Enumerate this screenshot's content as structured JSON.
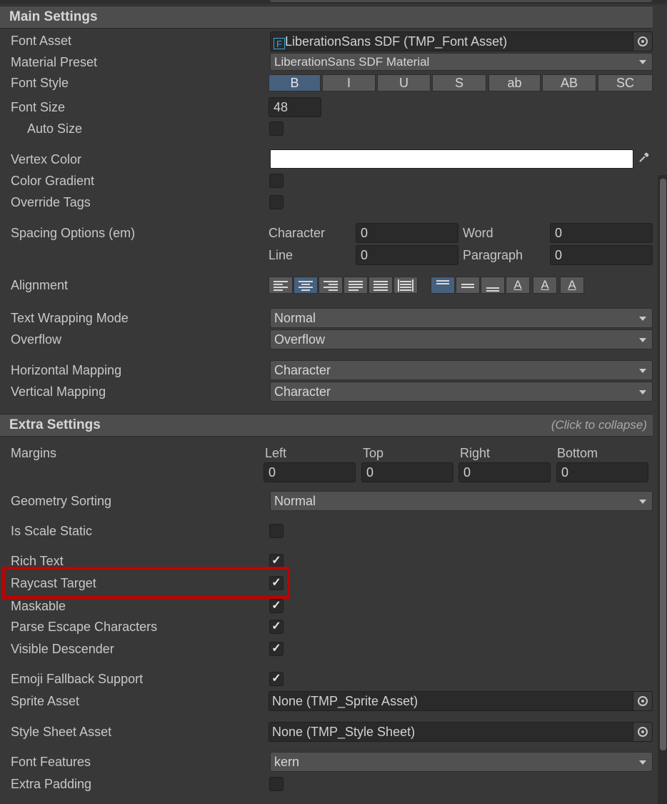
{
  "main_settings": {
    "header": "Main Settings",
    "font_asset": {
      "label": "Font Asset",
      "value": "LiberationSans SDF (TMP_Font Asset)",
      "icon": "font-asset-icon"
    },
    "material_preset": {
      "label": "Material Preset",
      "value": "LiberationSans SDF Material"
    },
    "font_style": {
      "label": "Font Style",
      "buttons": [
        "B",
        "I",
        "U",
        "S",
        "ab",
        "AB",
        "SC"
      ],
      "active": "B"
    },
    "font_size": {
      "label": "Font Size",
      "value": "48"
    },
    "auto_size": {
      "label": "Auto Size",
      "checked": false
    },
    "vertex_color": {
      "label": "Vertex Color",
      "color": "#ffffff"
    },
    "color_gradient": {
      "label": "Color Gradient",
      "checked": false
    },
    "override_tags": {
      "label": "Override Tags",
      "checked": false
    },
    "spacing": {
      "label": "Spacing Options (em)",
      "character_label": "Character",
      "character_value": "0",
      "word_label": "Word",
      "word_value": "0",
      "line_label": "Line",
      "line_value": "0",
      "paragraph_label": "Paragraph",
      "paragraph_value": "0"
    },
    "alignment": {
      "label": "Alignment",
      "horizontal_active": "center",
      "vertical_active": "top"
    },
    "text_wrapping": {
      "label": "Text Wrapping Mode",
      "value": "Normal"
    },
    "overflow": {
      "label": "Overflow",
      "value": "Overflow"
    },
    "horizontal_mapping": {
      "label": "Horizontal Mapping",
      "value": "Character"
    },
    "vertical_mapping": {
      "label": "Vertical Mapping",
      "value": "Character"
    }
  },
  "extra_settings": {
    "header": "Extra Settings",
    "hint": "(Click to collapse)",
    "margins": {
      "label": "Margins",
      "left_label": "Left",
      "left_value": "0",
      "top_label": "Top",
      "top_value": "0",
      "right_label": "Right",
      "right_value": "0",
      "bottom_label": "Bottom",
      "bottom_value": "0"
    },
    "geometry_sorting": {
      "label": "Geometry Sorting",
      "value": "Normal"
    },
    "is_scale_static": {
      "label": "Is Scale Static",
      "checked": false
    },
    "rich_text": {
      "label": "Rich Text",
      "checked": true
    },
    "raycast_target": {
      "label": "Raycast Target",
      "checked": true,
      "highlighted": true
    },
    "maskable": {
      "label": "Maskable",
      "checked": true
    },
    "parse_escape": {
      "label": "Parse Escape Characters",
      "checked": true
    },
    "visible_descender": {
      "label": "Visible Descender",
      "checked": true
    },
    "emoji_fallback": {
      "label": "Emoji Fallback Support",
      "checked": true
    },
    "sprite_asset": {
      "label": "Sprite Asset",
      "value": "None (TMP_Sprite Asset)"
    },
    "style_sheet_asset": {
      "label": "Style Sheet Asset",
      "value": "None (TMP_Style Sheet)"
    },
    "font_features": {
      "label": "Font Features",
      "value": "kern"
    },
    "extra_padding": {
      "label": "Extra Padding",
      "checked": false
    }
  },
  "checkmark_glyph": "✓",
  "colors": {
    "highlight": "#c00000",
    "active_button": "#46607e"
  }
}
